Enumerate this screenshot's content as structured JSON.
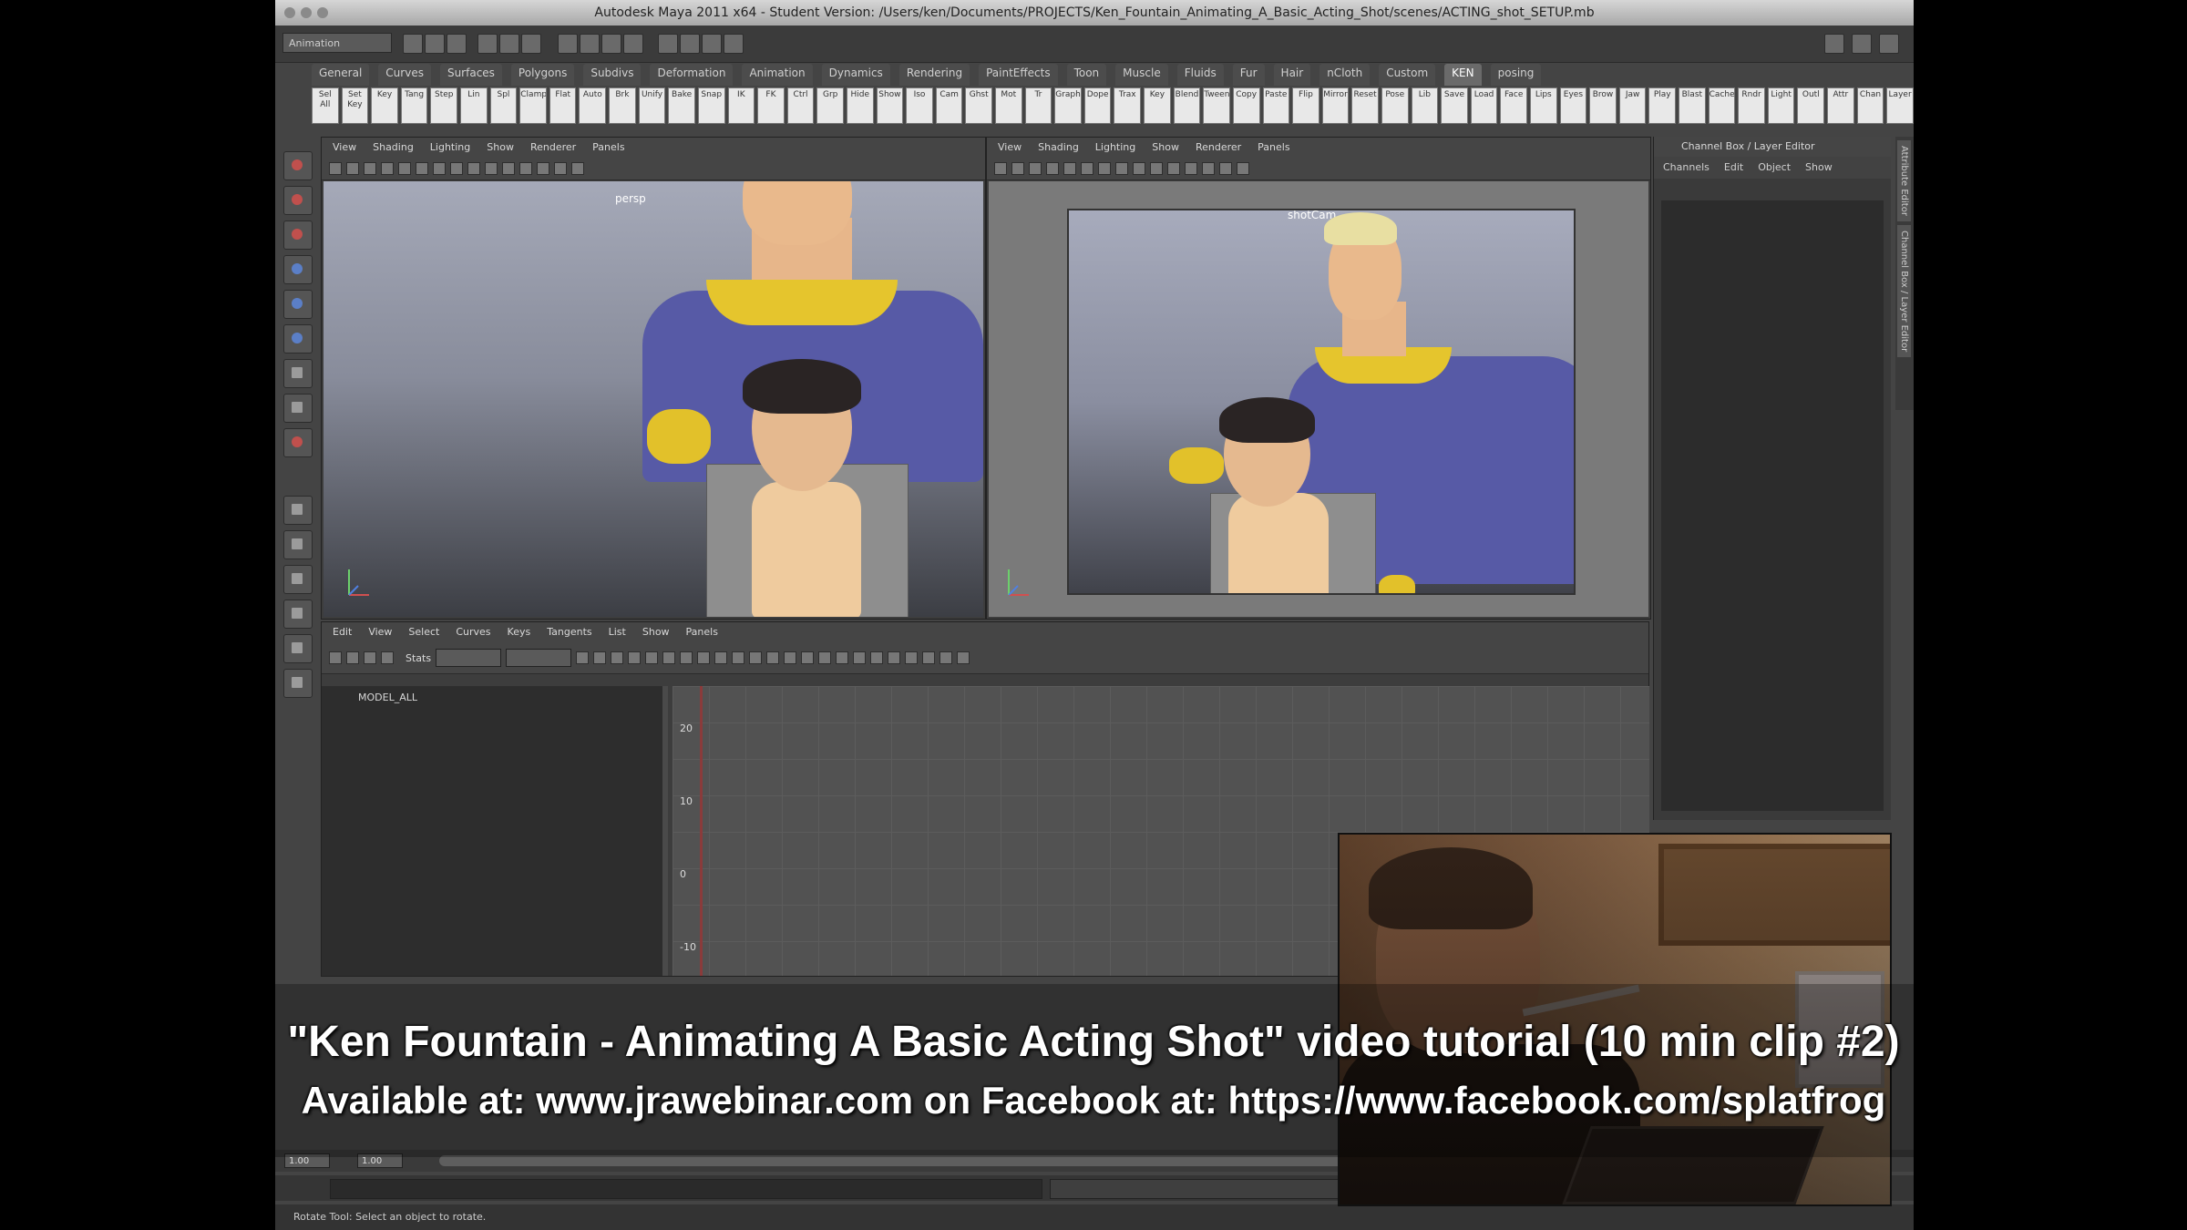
{
  "window": {
    "title": "Autodesk Maya 2011 x64 - Student Version: /Users/ken/Documents/PROJECTS/Ken_Fountain_Animating_A_Basic_Acting_Shot/scenes/ACTING_shot_SETUP.mb"
  },
  "status_line": {
    "mode": "Animation"
  },
  "shelf": {
    "tabs": [
      "General",
      "Curves",
      "Surfaces",
      "Polygons",
      "Subdivs",
      "Deformation",
      "Animation",
      "Dynamics",
      "Rendering",
      "PaintEffects",
      "Toon",
      "Muscle",
      "Fluids",
      "Fur",
      "Hair",
      "nCloth",
      "Custom",
      "KEN",
      "posing"
    ],
    "active_tab": "KEN",
    "buttons": [
      "Sel All",
      "Set Key",
      "Key",
      "Tang",
      "Step",
      "Lin",
      "Spl",
      "Clamp",
      "Flat",
      "Auto",
      "Brk",
      "Unify",
      "Bake",
      "Snap",
      "IK",
      "FK",
      "Ctrl",
      "Grp",
      "Hide",
      "Show",
      "Iso",
      "Cam",
      "Ghst",
      "Mot",
      "Tr",
      "Graph",
      "Dope",
      "Trax",
      "Key",
      "Blend",
      "Tween",
      "Copy",
      "Paste",
      "Flip",
      "Mirror",
      "Reset",
      "Pose",
      "Lib",
      "Save",
      "Load",
      "Face",
      "Lips",
      "Eyes",
      "Brow",
      "Jaw",
      "Play",
      "Blast",
      "Cache",
      "Rndr",
      "Light",
      "Outl",
      "Attr",
      "Chan",
      "Layer"
    ]
  },
  "viewports": {
    "left": {
      "menus": [
        "View",
        "Shading",
        "Lighting",
        "Show",
        "Renderer",
        "Panels"
      ],
      "label": "persp"
    },
    "right": {
      "menus": [
        "View",
        "Shading",
        "Lighting",
        "Show",
        "Renderer",
        "Panels"
      ],
      "label": "shotCam"
    }
  },
  "channel_box": {
    "title": "Channel Box / Layer Editor",
    "tabs": [
      "Channels",
      "Edit",
      "Object",
      "Show"
    ],
    "side_tabs": [
      "Attribute Editor",
      "Channel Box / Layer Editor"
    ]
  },
  "graph_editor": {
    "menus": [
      "Edit",
      "View",
      "Select",
      "Curves",
      "Keys",
      "Tangents",
      "List",
      "Show",
      "Panels"
    ],
    "stats_label": "Stats",
    "outliner_item": "MODEL_ALL",
    "y_labels": [
      "20",
      "10",
      "0",
      "-10"
    ]
  },
  "timeline": {
    "start": "1.00",
    "end": "1.00"
  },
  "help_line": "Rotate Tool: Select an object to rotate.",
  "caption": {
    "line1": "\"Ken Fountain - Animating A Basic Acting Shot\" video tutorial (10 min clip #2)",
    "line2": "Available at: www.jrawebinar.com    on Facebook at: https://www.facebook.com/splatfrog"
  }
}
